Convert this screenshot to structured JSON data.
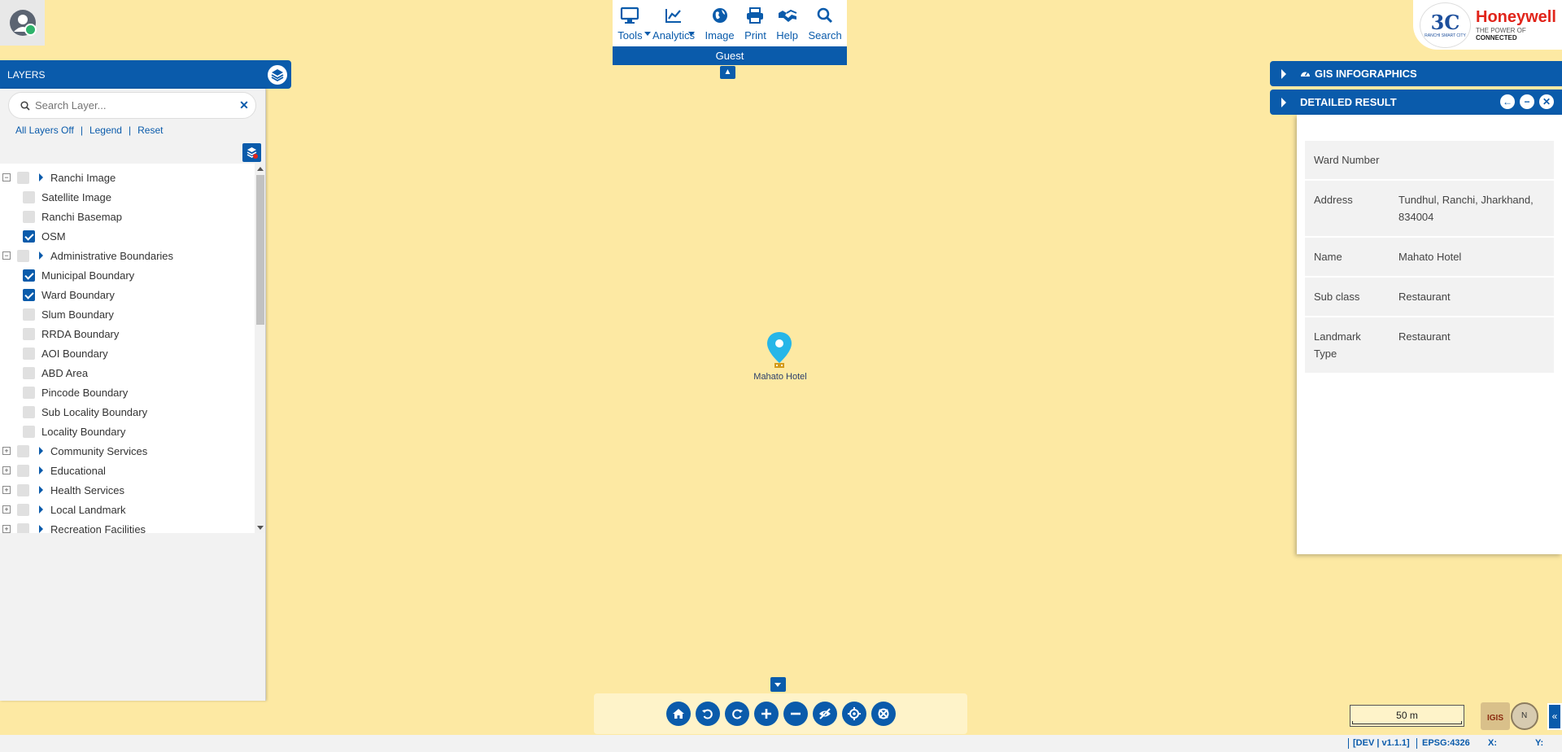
{
  "toolbar": {
    "tools": [
      {
        "label": "Tools",
        "icon": "monitor-icon",
        "dropdown": true
      },
      {
        "label": "Analytics",
        "icon": "chart-line-icon",
        "dropdown": true
      },
      {
        "label": "Image",
        "icon": "globe-icon",
        "dropdown": false
      },
      {
        "label": "Print",
        "icon": "print-icon",
        "dropdown": false
      },
      {
        "label": "Help",
        "icon": "handshake-icon",
        "dropdown": false
      },
      {
        "label": "Search",
        "icon": "search-icon",
        "dropdown": false
      }
    ],
    "user": "Guest"
  },
  "logo": {
    "brand": "Honeywell",
    "tagline_prefix": "THE POWER OF",
    "tagline_bold": "CONNECTED",
    "city_mark": "3C",
    "city_caption": "RANCHI SMART CITY"
  },
  "layers": {
    "title": "LAYERS",
    "search_placeholder": "Search Layer...",
    "links": {
      "all_off": "All Layers Off",
      "legend": "Legend",
      "reset": "Reset"
    },
    "items": [
      {
        "label": "Ranchi Image",
        "level": 0,
        "group": true,
        "expander": "−",
        "checked": false
      },
      {
        "label": "Satellite Image",
        "level": 1,
        "checked": false
      },
      {
        "label": "Ranchi Basemap",
        "level": 1,
        "checked": false
      },
      {
        "label": "OSM",
        "level": 1,
        "checked": true
      },
      {
        "label": "Administrative Boundaries",
        "level": 0,
        "group": true,
        "expander": "−",
        "checked": false
      },
      {
        "label": "Municipal Boundary",
        "level": 1,
        "checked": true
      },
      {
        "label": "Ward Boundary",
        "level": 1,
        "checked": true
      },
      {
        "label": "Slum Boundary",
        "level": 1,
        "checked": false
      },
      {
        "label": "RRDA Boundary",
        "level": 1,
        "checked": false
      },
      {
        "label": "AOI Boundary",
        "level": 1,
        "checked": false
      },
      {
        "label": "ABD Area",
        "level": 1,
        "checked": false
      },
      {
        "label": "Pincode Boundary",
        "level": 1,
        "checked": false
      },
      {
        "label": "Sub Locality Boundary",
        "level": 1,
        "checked": false
      },
      {
        "label": "Locality Boundary",
        "level": 1,
        "checked": false
      },
      {
        "label": "Community Services",
        "level": 0,
        "group": true,
        "expander": "+",
        "checked": false
      },
      {
        "label": "Educational",
        "level": 0,
        "group": true,
        "expander": "+",
        "checked": false
      },
      {
        "label": "Health Services",
        "level": 0,
        "group": true,
        "expander": "+",
        "checked": false
      },
      {
        "label": "Local Landmark",
        "level": 0,
        "group": true,
        "expander": "+",
        "checked": false
      },
      {
        "label": "Recreation Facilities",
        "level": 0,
        "group": true,
        "expander": "+",
        "checked": false
      }
    ]
  },
  "map": {
    "marker_label": "Mahato Hotel",
    "background": "#fde9a3"
  },
  "panels": {
    "gis_title": "GIS INFOGRAPHICS",
    "detail_title": "DETAILED RESULT"
  },
  "detail_rows": [
    {
      "key": "Ward Number",
      "value": ""
    },
    {
      "key": "Address",
      "value": "Tundhul, Ranchi, Jharkhand, 834004"
    },
    {
      "key": "Name",
      "value": "Mahato Hotel"
    },
    {
      "key": "Sub class",
      "value": "Restaurant"
    },
    {
      "key": "Landmark Type",
      "value": "Restaurant"
    }
  ],
  "navbar": {
    "buttons": [
      "home-icon",
      "undo-icon",
      "redo-icon",
      "zoom-in-icon",
      "zoom-out-icon",
      "hide-icon",
      "locate-icon",
      "clear-icon"
    ]
  },
  "scale": {
    "label": "50 m"
  },
  "igis": {
    "label": "IGIS"
  },
  "status": {
    "version": "[DEV | v1.1.1]",
    "epsg": "EPSG:4326",
    "x_label": "X:",
    "y_label": "Y:"
  },
  "colors": {
    "primary": "#0a5bab",
    "map": "#fde9a3",
    "brand_red": "#e1251b"
  }
}
